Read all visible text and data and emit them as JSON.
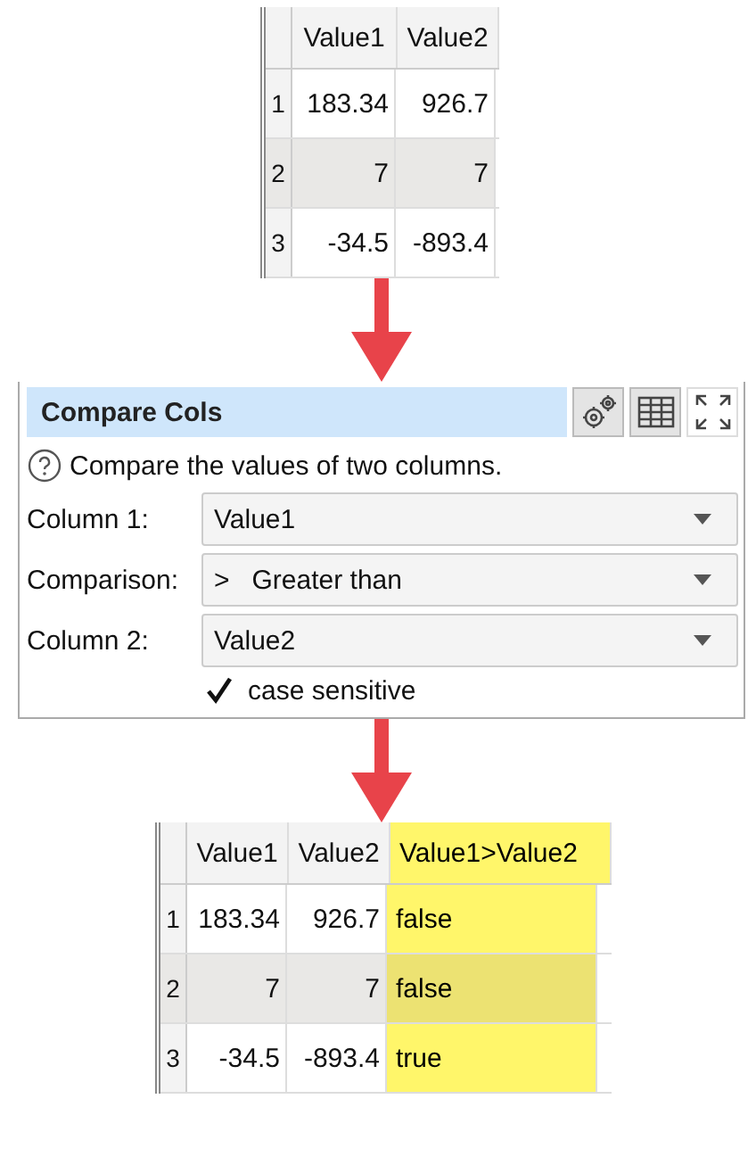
{
  "input_table": {
    "columns": [
      {
        "label": "Value1",
        "highlighted": false
      },
      {
        "label": "Value2",
        "highlighted": false
      }
    ],
    "rows": [
      {
        "number": "1",
        "selected": false,
        "cells": [
          "183.34",
          "926.7"
        ]
      },
      {
        "number": "2",
        "selected": true,
        "cells": [
          "7",
          "7"
        ]
      },
      {
        "number": "3",
        "selected": false,
        "cells": [
          "-34.5",
          "-893.4"
        ]
      }
    ]
  },
  "panel": {
    "title": "Compare Cols",
    "description": "Compare the values of two columns.",
    "fields": [
      {
        "label": "Column 1:",
        "value": "Value1"
      },
      {
        "label": "Comparison:",
        "value": ">   Greater than"
      },
      {
        "label": "Column 2:",
        "value": "Value2"
      }
    ],
    "checkbox": {
      "label": "case sensitive",
      "checked": true
    }
  },
  "output_table": {
    "columns": [
      {
        "label": "Value1",
        "highlighted": false
      },
      {
        "label": "Value2",
        "highlighted": false
      },
      {
        "label": "Value1>Value2",
        "highlighted": true
      }
    ],
    "rows": [
      {
        "number": "1",
        "selected": false,
        "cells": [
          "183.34",
          "926.7",
          "false"
        ]
      },
      {
        "number": "2",
        "selected": true,
        "cells": [
          "7",
          "7",
          "false"
        ]
      },
      {
        "number": "3",
        "selected": false,
        "cells": [
          "-34.5",
          "-893.4",
          "true"
        ]
      }
    ]
  }
}
